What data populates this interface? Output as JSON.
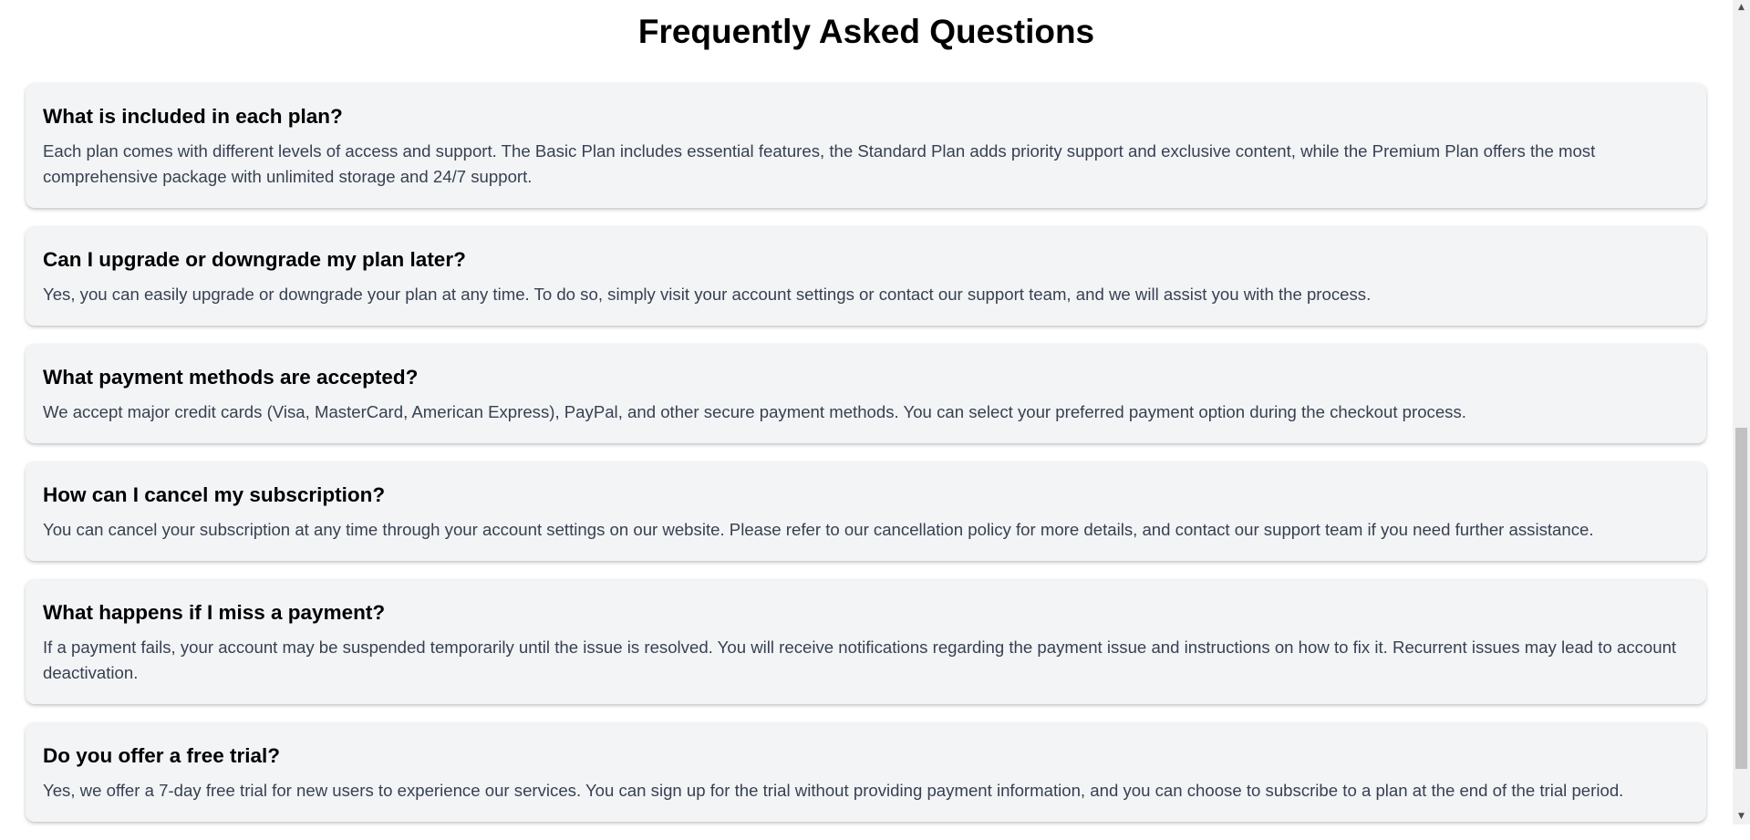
{
  "faq": {
    "title": "Frequently Asked Questions",
    "items": [
      {
        "question": "What is included in each plan?",
        "answer": "Each plan comes with different levels of access and support. The Basic Plan includes essential features, the Standard Plan adds priority support and exclusive content, while the Premium Plan offers the most comprehensive package with unlimited storage and 24/7 support."
      },
      {
        "question": "Can I upgrade or downgrade my plan later?",
        "answer": "Yes, you can easily upgrade or downgrade your plan at any time. To do so, simply visit your account settings or contact our support team, and we will assist you with the process."
      },
      {
        "question": "What payment methods are accepted?",
        "answer": "We accept major credit cards (Visa, MasterCard, American Express), PayPal, and other secure payment methods. You can select your preferred payment option during the checkout process."
      },
      {
        "question": "How can I cancel my subscription?",
        "answer": "You can cancel your subscription at any time through your account settings on our website. Please refer to our cancellation policy for more details, and contact our support team if you need further assistance."
      },
      {
        "question": "What happens if I miss a payment?",
        "answer": "If a payment fails, your account may be suspended temporarily until the issue is resolved. You will receive notifications regarding the payment issue and instructions on how to fix it. Recurrent issues may lead to account deactivation."
      },
      {
        "question": "Do you offer a free trial?",
        "answer": "Yes, we offer a 7-day free trial for new users to experience our services. You can sign up for the trial without providing payment information, and you can choose to subscribe to a plan at the end of the trial period."
      }
    ]
  },
  "scrollbar": {
    "up_icon": "triangle-up-icon",
    "down_icon": "triangle-down-icon"
  },
  "colors": {
    "card_background": "#f3f4f6",
    "question_text": "#000000",
    "answer_text": "#374151"
  }
}
